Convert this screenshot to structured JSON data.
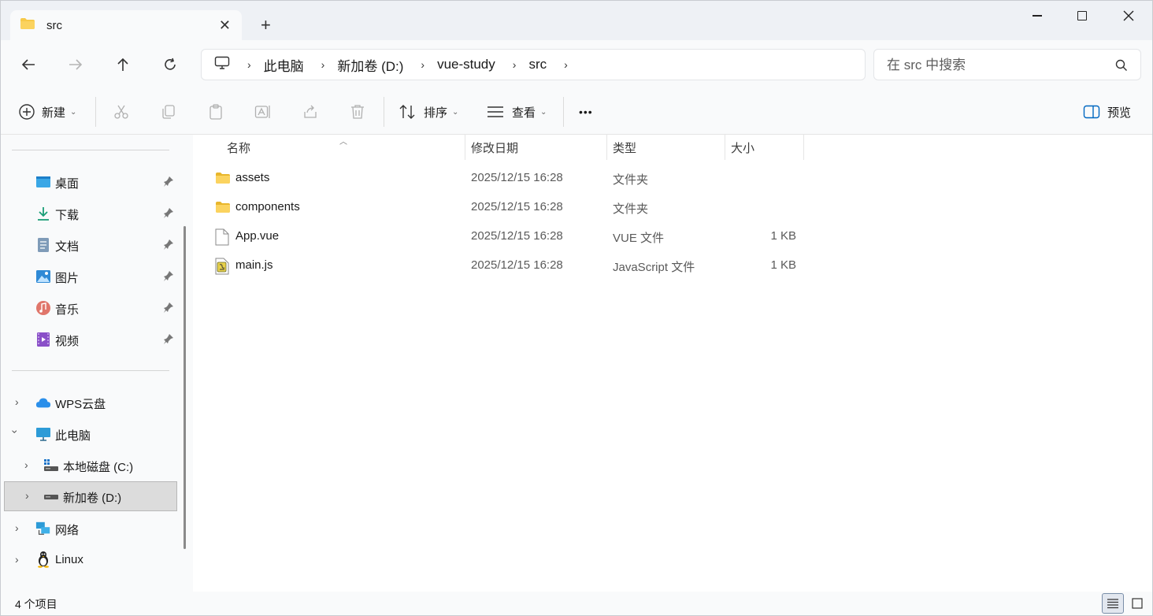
{
  "tab": {
    "title": "src",
    "close_glyph": "✕",
    "new_tab_glyph": "+"
  },
  "address": {
    "crumbs": [
      "此电脑",
      "新加卷 (D:)",
      "vue-study",
      "src"
    ],
    "separator": "›"
  },
  "search": {
    "placeholder": "在 src 中搜索"
  },
  "toolbar": {
    "new_label": "新建",
    "sort_label": "排序",
    "view_label": "查看",
    "more_glyph": "•••",
    "preview_label": "预览",
    "caret": "⌄"
  },
  "sidebar": {
    "quick_access": [
      {
        "label": "桌面",
        "icon": "desktop-icon"
      },
      {
        "label": "下载",
        "icon": "download-icon"
      },
      {
        "label": "文档",
        "icon": "document-icon"
      },
      {
        "label": "图片",
        "icon": "pictures-icon"
      },
      {
        "label": "音乐",
        "icon": "music-icon"
      },
      {
        "label": "视频",
        "icon": "video-icon"
      }
    ],
    "tree": [
      {
        "label": "WPS云盘",
        "icon": "cloud-icon"
      },
      {
        "label": "此电脑",
        "icon": "computer-icon"
      },
      {
        "label": "本地磁盘 (C:)",
        "icon": "drive-icon"
      },
      {
        "label": "新加卷 (D:)",
        "icon": "drive-icon"
      },
      {
        "label": "网络",
        "icon": "network-icon"
      },
      {
        "label": "Linux",
        "icon": "linux-icon"
      }
    ]
  },
  "columns": {
    "name": "名称",
    "modified": "修改日期",
    "type": "类型",
    "size": "大小"
  },
  "files": [
    {
      "name": "assets",
      "modified": "2025/12/15 16:28",
      "type": "文件夹",
      "size": "",
      "icon": "folder-icon"
    },
    {
      "name": "components",
      "modified": "2025/12/15 16:28",
      "type": "文件夹",
      "size": "",
      "icon": "folder-icon"
    },
    {
      "name": "App.vue",
      "modified": "2025/12/15 16:28",
      "type": "VUE 文件",
      "size": "1 KB",
      "icon": "file-icon"
    },
    {
      "name": "main.js",
      "modified": "2025/12/15 16:28",
      "type": "JavaScript 文件",
      "size": "1 KB",
      "icon": "js-file-icon"
    }
  ],
  "status": {
    "item_count": "4 个项目"
  },
  "colors": {
    "accent": "#0067c0",
    "folder": "#f7c948",
    "selected_bg": "#dcdcdc"
  }
}
